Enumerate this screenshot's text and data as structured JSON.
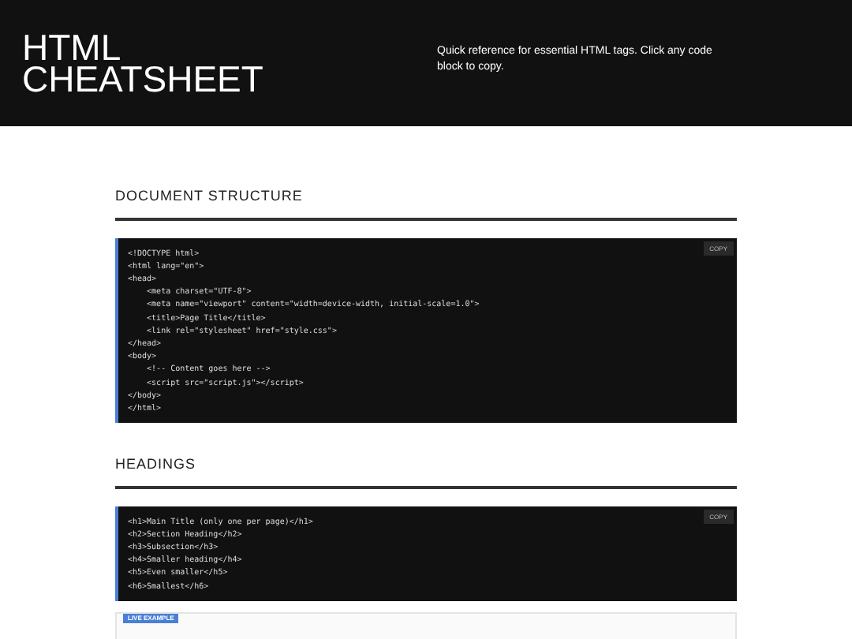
{
  "header": {
    "title": "HTML CHEATSHEET",
    "description": "Quick reference for essential HTML tags. Click any code block to copy."
  },
  "sections": [
    {
      "heading": "DOCUMENT STRUCTURE",
      "copy_label": "COPY",
      "code": [
        "<!DOCTYPE html>",
        "<html lang=\"en\">",
        "<head>",
        "    <meta charset=\"UTF-8\">",
        "    <meta name=\"viewport\" content=\"width=device-width, initial-scale=1.0\">",
        "    <title>Page Title</title>",
        "    <link rel=\"stylesheet\" href=\"style.css\">",
        "</head>",
        "<body>",
        "    <!-- Content goes here -->",
        "    <script src=\"script.js\"></script>",
        "</body>",
        "</html>"
      ]
    },
    {
      "heading": "HEADINGS",
      "copy_label": "COPY",
      "code": [
        "<h1>Main Title (only one per page)</h1>",
        "<h2>Section Heading</h2>",
        "<h3>Subsection</h3>",
        "<h4>Smaller heading</h4>",
        "<h5>Even smaller</h5>",
        "<h6>Smallest</h6>"
      ],
      "live_example_label": "LIVE EXAMPLE"
    }
  ]
}
